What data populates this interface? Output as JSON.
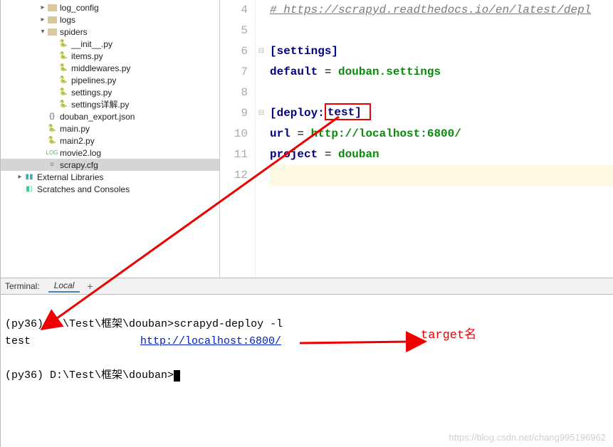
{
  "tree": {
    "nodes": [
      {
        "ind": 3,
        "exp": ">",
        "icon": "folder",
        "label": "log_config"
      },
      {
        "ind": 3,
        "exp": ">",
        "icon": "folder",
        "label": "logs"
      },
      {
        "ind": 3,
        "exp": "v",
        "icon": "folder",
        "label": "spiders"
      },
      {
        "ind": 4,
        "exp": "",
        "icon": "py",
        "label": "__init__.py"
      },
      {
        "ind": 4,
        "exp": "",
        "icon": "py",
        "label": "items.py"
      },
      {
        "ind": 4,
        "exp": "",
        "icon": "py",
        "label": "middlewares.py"
      },
      {
        "ind": 4,
        "exp": "",
        "icon": "py",
        "label": "pipelines.py"
      },
      {
        "ind": 4,
        "exp": "",
        "icon": "py",
        "label": "settings.py"
      },
      {
        "ind": 4,
        "exp": "",
        "icon": "py",
        "label": "settings详解.py"
      },
      {
        "ind": 3,
        "exp": "",
        "icon": "json",
        "label": "douban_export.json"
      },
      {
        "ind": 3,
        "exp": "",
        "icon": "py",
        "label": "main.py"
      },
      {
        "ind": 3,
        "exp": "",
        "icon": "py",
        "label": "main2.py"
      },
      {
        "ind": 3,
        "exp": "",
        "icon": "log",
        "label": "movie2.log"
      },
      {
        "ind": 3,
        "exp": "",
        "icon": "cfg",
        "label": "scrapy.cfg",
        "selected": true
      },
      {
        "ind": 1,
        "exp": ">",
        "icon": "lib",
        "label": "External Libraries"
      },
      {
        "ind": 1,
        "exp": "",
        "icon": "scratch",
        "label": "Scratches and Consoles"
      }
    ]
  },
  "editor": {
    "lines": [
      {
        "n": 4,
        "fold": "",
        "type": "comment",
        "raw": "# https://scrapyd.readthedocs.io/en/latest/depl"
      },
      {
        "n": 5,
        "fold": "",
        "type": "blank",
        "raw": ""
      },
      {
        "n": 6,
        "fold": "-",
        "type": "section",
        "raw": "[settings]"
      },
      {
        "n": 7,
        "fold": "",
        "type": "kv",
        "key": "default",
        "val": "douban.settings"
      },
      {
        "n": 8,
        "fold": "",
        "type": "blank",
        "raw": ""
      },
      {
        "n": 9,
        "fold": "-",
        "type": "deploy",
        "section_pre": "[deploy:",
        "target": "test",
        "section_post": "]"
      },
      {
        "n": 10,
        "fold": "",
        "type": "kv",
        "key": "url",
        "val": "http://localhost:6800/"
      },
      {
        "n": 11,
        "fold": "",
        "type": "kv",
        "key": "project",
        "val": "douban"
      },
      {
        "n": 12,
        "fold": "",
        "type": "current",
        "raw": ""
      }
    ]
  },
  "terminal_bar": {
    "label": "Terminal:",
    "tab": "Local",
    "plus": "+"
  },
  "terminal": {
    "prompt1_pre": "(py36) D:\\Test\\框架\\douban>",
    "cmd1": "scrapyd-deploy -l",
    "out_name": "test",
    "out_url": "http://localhost:6800/",
    "prompt2": "(py36) D:\\Test\\框架\\douban>"
  },
  "annotation": {
    "target_label": "target名"
  },
  "watermark": "https://blog.csdn.net/chang995196962"
}
